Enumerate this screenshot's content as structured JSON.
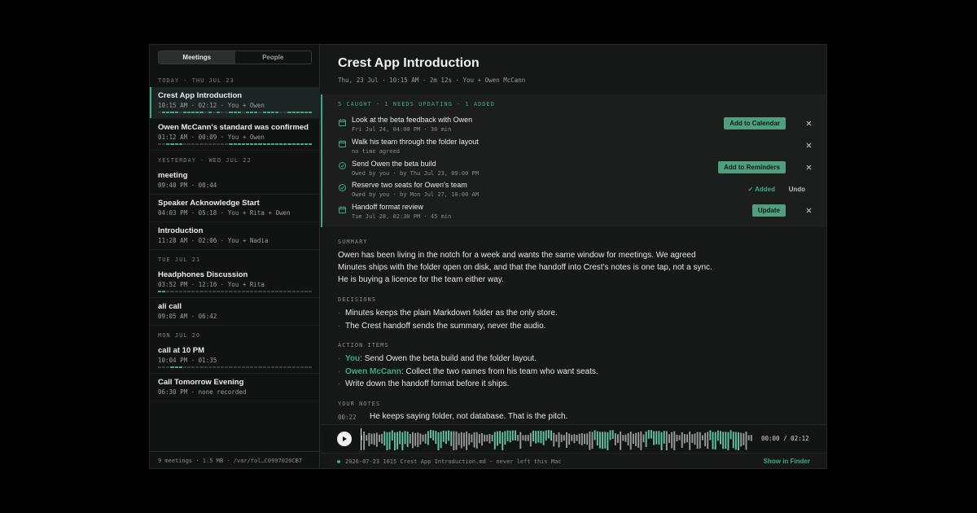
{
  "sidebar": {
    "tabs": [
      {
        "label": "Meetings",
        "active": true
      },
      {
        "label": "People",
        "active": false
      }
    ],
    "groups": [
      {
        "header": "TODAY · THU JUL 23",
        "items": [
          {
            "title": "Crest App Introduction",
            "meta": "10:15 AM · 02:12 · You + Owen",
            "bar": "0111101111101010011101110111100111111",
            "active": true
          },
          {
            "title": "Owen McCann's standard was confirmed",
            "meta": "01:12 AM · 00:09 · You + Owen",
            "bar": "0011110000000000011111111111111111111"
          }
        ]
      },
      {
        "header": "YESTERDAY · WED JUL 22",
        "items": [
          {
            "title": "meeting",
            "meta": "09:40 PM · 00:44"
          },
          {
            "title": "Speaker Acknowledge Start",
            "meta": "04:03 PM · 05:18 · You + Rita + Owen"
          },
          {
            "title": "Introduction",
            "meta": "11:28 AM · 02:06 · You + Nadia"
          }
        ]
      },
      {
        "header": "TUE JUL 21",
        "items": [
          {
            "title": "Headphones Discussion",
            "meta": "03:52 PM · 12:16 · You + Rita",
            "bar": "1100000000000000000000000000000000000"
          },
          {
            "title": "ali call",
            "meta": "09:05 AM · 06:42"
          }
        ]
      },
      {
        "header": "MON JUL 20",
        "items": [
          {
            "title": "call at 10 PM",
            "meta": "10:04 PM · 01:35",
            "bar": "0001110000000000000000000000000000000"
          },
          {
            "title": "Call Tomorrow Evening",
            "meta": "06:30 PM · none recorded"
          }
        ]
      }
    ],
    "footer": "9 meetings · 1.5 MB · /var/fol…C0997020CB7"
  },
  "main": {
    "title": "Crest App Introduction",
    "subtitle": "Thu, 23 Jul · 10:15 AM · 2m 12s · You + Owen McCann",
    "caught_header": "5 CAUGHT · 1 NEEDS UPDATING · 1 ADDED",
    "tasks": [
      {
        "icon": "calendar-icon",
        "title": "Look at the beta feedback with Owen",
        "meta": "Fri Jul 24, 04:00 PM · 30 min",
        "action": "Add to Calendar"
      },
      {
        "icon": "calendar-icon",
        "title": "Walk his team through the folder layout",
        "meta": "no time agreed",
        "action": ""
      },
      {
        "icon": "check-circle-icon",
        "title": "Send Owen the beta build",
        "meta": "Owed by you · by Thu Jul 23, 09:00 PM",
        "action": "Add to Reminders"
      },
      {
        "icon": "check-circle-icon",
        "title": "Reserve two seats for Owen's team",
        "meta": "Owed by you · by Mon Jul 27, 10:00 AM",
        "action": "",
        "added": "✓ Added",
        "undo": "Undo"
      },
      {
        "icon": "calendar-icon",
        "title": "Handoff format review",
        "meta": "Tue Jul 28, 02:30 PM · 45 min",
        "action": "Update"
      }
    ],
    "summary_label": "SUMMARY",
    "summary": "Owen has been living in the notch for a week and wants the same window for meetings. We agreed Minutes ships with the folder open on disk, and that the handoff into Crest's notes is one tap, not a sync. He is buying a licence for the team either way.",
    "decisions_label": "DECISIONS",
    "decisions": [
      "Minutes keeps the plain Markdown folder as the only store.",
      "The Crest handoff sends the summary, never the audio."
    ],
    "action_items_label": "ACTION ITEMS",
    "action_items": [
      {
        "owner": "You",
        "text": ": Send Owen the beta build and the folder layout."
      },
      {
        "owner": "Owen McCann",
        "text": ": Collect the two names from his team who want seats."
      },
      {
        "owner": "",
        "text": "Write down the handoff format before it ships."
      }
    ],
    "notes_label": "YOUR NOTES",
    "notes": [
      {
        "time": "00:22",
        "text": "He keeps saying folder, not database. That is the pitch."
      }
    ],
    "player": {
      "time": "00:00 / 02:12",
      "progress": 0,
      "waveform": "gggggggggttttttttttgggggggttttttttttggggggggggggggggtttttttttggggggttttttttggggggggggggggggttttttttggggggggggggttttttttgggggggggggggggggttttttttttttggggg"
    },
    "footer": {
      "file": "2026-07-23 1015 Crest App Introduction.md · never left this Mac",
      "finder": "Show in Finder"
    }
  },
  "colors": {
    "accent": "#3ea987",
    "button": "#4f9e80",
    "background": "#161818",
    "sidebar": "#111313"
  }
}
